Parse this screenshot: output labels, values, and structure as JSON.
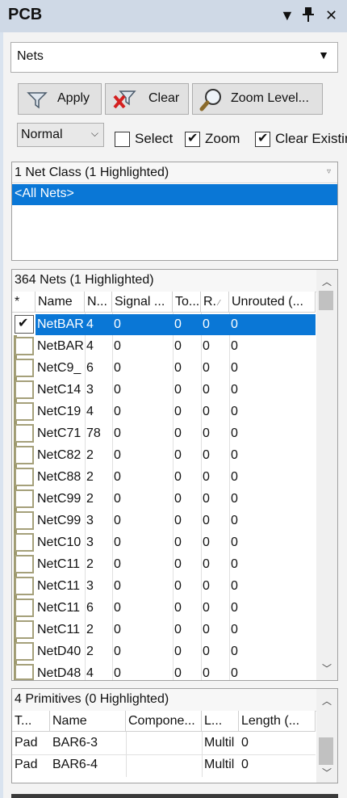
{
  "panel": {
    "title": "PCB"
  },
  "title_controls": [
    "▼",
    "📌",
    "✕"
  ],
  "mode_dropdown": {
    "value": "Nets"
  },
  "toolbar": {
    "apply_label": "Apply",
    "clear_label": "Clear",
    "zoom_level_label": "Zoom Level..."
  },
  "options": {
    "mask_mode": "Normal",
    "select": {
      "label": "Select",
      "checked": false
    },
    "zoom": {
      "label": "Zoom",
      "checked": true
    },
    "clear_existing": {
      "label": "Clear Existin",
      "checked": true
    }
  },
  "net_classes": {
    "header": "1 Net Class (1 Highlighted)",
    "items": [
      "<All Nets>"
    ]
  },
  "nets": {
    "header": "364 Nets (1 Highlighted)",
    "columns": [
      "*",
      "Name",
      "N...",
      "Signal ...",
      "To...",
      "R.",
      "Unrouted (..."
    ],
    "rows": [
      {
        "checked": true,
        "name": "NetBAR",
        "nodes": "4",
        "signal": "0",
        "total": "0",
        "routed": "0",
        "unrouted": "0",
        "selected": true
      },
      {
        "checked": false,
        "name": "NetBAR",
        "nodes": "4",
        "signal": "0",
        "total": "0",
        "routed": "0",
        "unrouted": "0"
      },
      {
        "checked": false,
        "name": "NetC9_",
        "nodes": "6",
        "signal": "0",
        "total": "0",
        "routed": "0",
        "unrouted": "0"
      },
      {
        "checked": false,
        "name": "NetC14",
        "nodes": "3",
        "signal": "0",
        "total": "0",
        "routed": "0",
        "unrouted": "0"
      },
      {
        "checked": false,
        "name": "NetC19",
        "nodes": "4",
        "signal": "0",
        "total": "0",
        "routed": "0",
        "unrouted": "0"
      },
      {
        "checked": false,
        "name": "NetC71",
        "nodes": "78",
        "signal": "0",
        "total": "0",
        "routed": "0",
        "unrouted": "0"
      },
      {
        "checked": false,
        "name": "NetC82",
        "nodes": "2",
        "signal": "0",
        "total": "0",
        "routed": "0",
        "unrouted": "0"
      },
      {
        "checked": false,
        "name": "NetC88",
        "nodes": "2",
        "signal": "0",
        "total": "0",
        "routed": "0",
        "unrouted": "0"
      },
      {
        "checked": false,
        "name": "NetC99",
        "nodes": "2",
        "signal": "0",
        "total": "0",
        "routed": "0",
        "unrouted": "0"
      },
      {
        "checked": false,
        "name": "NetC99",
        "nodes": "3",
        "signal": "0",
        "total": "0",
        "routed": "0",
        "unrouted": "0"
      },
      {
        "checked": false,
        "name": "NetC10",
        "nodes": "3",
        "signal": "0",
        "total": "0",
        "routed": "0",
        "unrouted": "0"
      },
      {
        "checked": false,
        "name": "NetC11",
        "nodes": "2",
        "signal": "0",
        "total": "0",
        "routed": "0",
        "unrouted": "0"
      },
      {
        "checked": false,
        "name": "NetC11",
        "nodes": "3",
        "signal": "0",
        "total": "0",
        "routed": "0",
        "unrouted": "0"
      },
      {
        "checked": false,
        "name": "NetC11",
        "nodes": "6",
        "signal": "0",
        "total": "0",
        "routed": "0",
        "unrouted": "0"
      },
      {
        "checked": false,
        "name": "NetC11",
        "nodes": "2",
        "signal": "0",
        "total": "0",
        "routed": "0",
        "unrouted": "0"
      },
      {
        "checked": false,
        "name": "NetD40",
        "nodes": "2",
        "signal": "0",
        "total": "0",
        "routed": "0",
        "unrouted": "0"
      },
      {
        "checked": false,
        "name": "NetD48",
        "nodes": "4",
        "signal": "0",
        "total": "0",
        "routed": "0",
        "unrouted": "0"
      }
    ]
  },
  "primitives": {
    "header": "4 Primitives (0 Highlighted)",
    "columns": [
      "T...",
      "Name",
      "Compone...",
      "L...",
      "Length (..."
    ],
    "rows": [
      {
        "type": "Pad",
        "name": "BAR6-3",
        "component": "",
        "layer": "Multil",
        "length": "0"
      },
      {
        "type": "Pad",
        "name": "BAR6-4",
        "component": "",
        "layer": "Multil",
        "length": "0"
      }
    ]
  },
  "colors": {
    "selection": "#0a77d6",
    "highlight_band": "#9c986c",
    "panel_background": "#d9e3ef"
  }
}
